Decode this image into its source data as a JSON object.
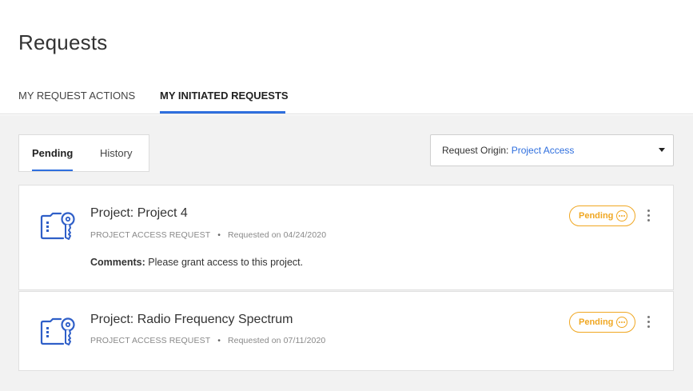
{
  "page": {
    "title": "Requests"
  },
  "tabs": [
    {
      "label": "MY REQUEST ACTIONS"
    },
    {
      "label": "MY INITIATED REQUESTS"
    }
  ],
  "subtabs": [
    {
      "label": "Pending"
    },
    {
      "label": "History"
    }
  ],
  "filter": {
    "label": "Request Origin:",
    "value": "Project Access"
  },
  "requests": [
    {
      "title": "Project: Project 4",
      "type": "PROJECT ACCESS REQUEST",
      "requested": "Requested on 04/24/2020",
      "comments_label": "Comments:",
      "comments": "Please grant access to this project.",
      "status": "Pending"
    },
    {
      "title": "Project: Radio Frequency Spectrum",
      "type": "PROJECT ACCESS REQUEST",
      "requested": "Requested on 07/11/2020",
      "status": "Pending"
    }
  ],
  "icons": {
    "request": "key-folder-icon",
    "status": "ellipsis-circle-icon",
    "menu": "kebab-menu-icon",
    "dropdown": "caret-down-icon"
  },
  "colors": {
    "accent": "#2f6fde",
    "pending": "#f0a722",
    "icon": "#2f5fc8"
  }
}
